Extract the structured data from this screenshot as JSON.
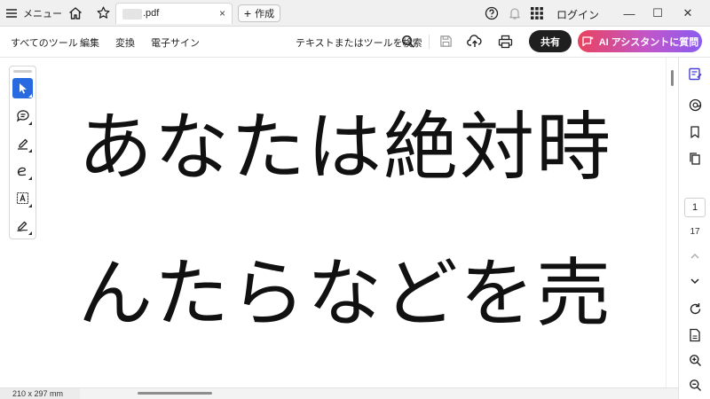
{
  "titlebar": {
    "menu_label": "メニュー",
    "tab": {
      "title": ".pdf",
      "close": "×"
    },
    "create_label": "作成",
    "login_label": "ログイン",
    "window_controls": {
      "minimize": "—",
      "maximize": "☐",
      "close": "✕"
    }
  },
  "toolbar": {
    "menus": [
      "すべてのツール",
      "編集",
      "変換",
      "電子サイン"
    ],
    "search_label": "テキストまたはツールを検索",
    "share_label": "共有",
    "ai_label": "AI アシスタントに質問"
  },
  "document": {
    "lines": [
      "あなたは絶対時",
      "んたらなどを売"
    ]
  },
  "left_tools": {
    "icons": [
      "select-cursor-icon",
      "comment-icon",
      "highlight-pen-icon",
      "freehand-draw-icon",
      "text-box-icon",
      "sign-icon"
    ]
  },
  "right_panel": {
    "current_page": "1",
    "total_pages": "17"
  },
  "statusbar": {
    "page_size": "210 x 297 mm"
  },
  "colors": {
    "accent": "#2a6ae0",
    "share_bg": "#1f1f1f",
    "ai_gradient_start": "#e8435d",
    "ai_gradient_end": "#8a5cf0",
    "panel_icon_active": "#4a3fd6"
  }
}
